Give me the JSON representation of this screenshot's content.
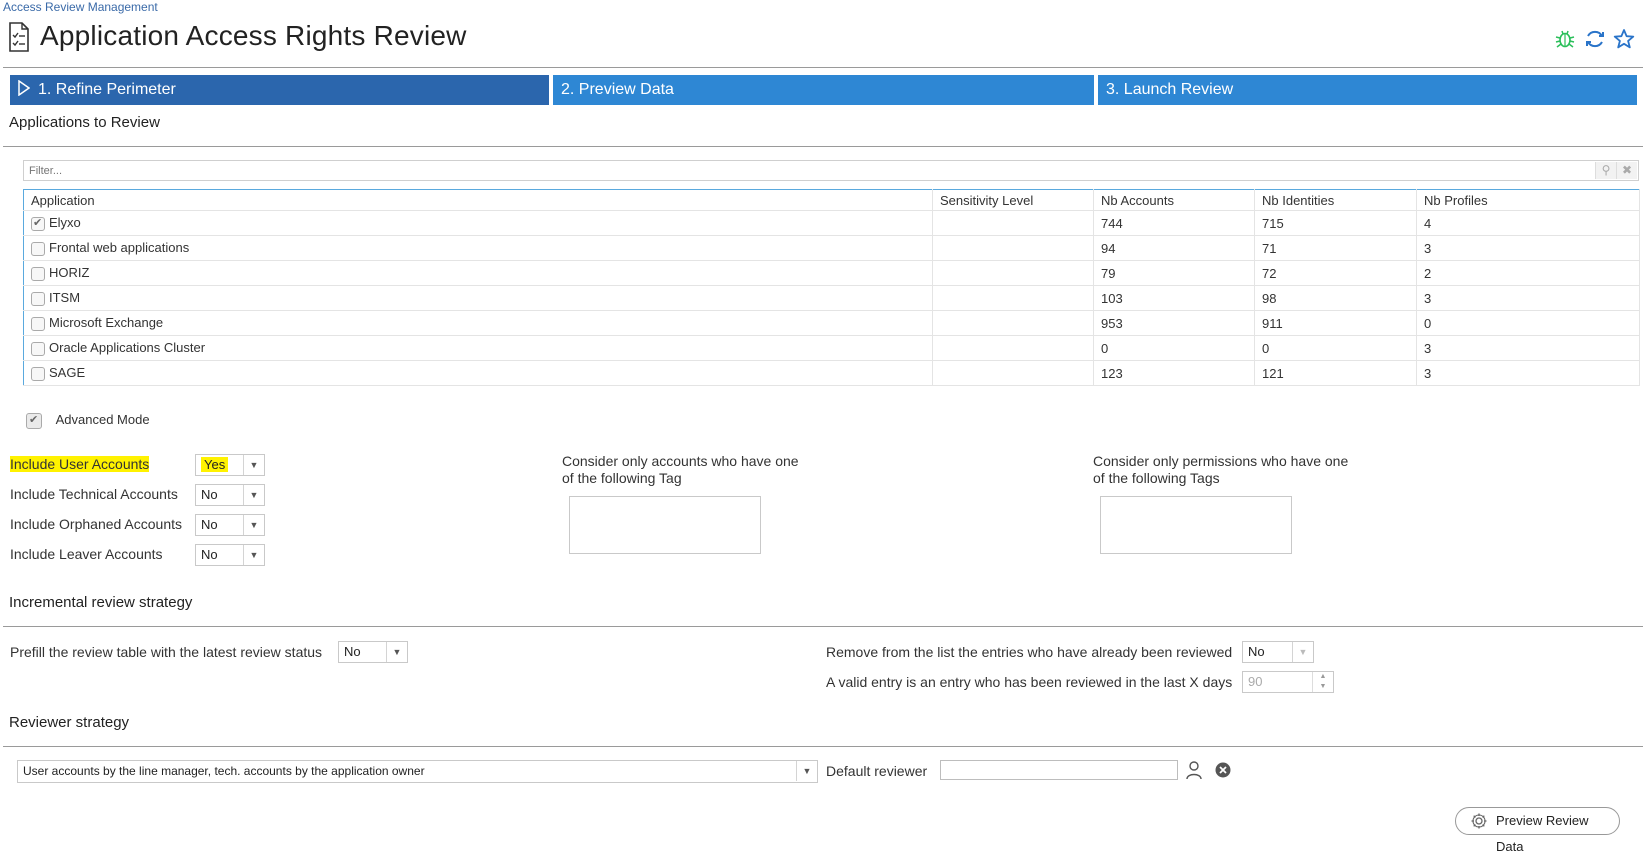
{
  "breadcrumb": "Access Review Management",
  "page_title": "Application Access Rights Review",
  "steps": [
    {
      "label": "1. Refine Perimeter"
    },
    {
      "label": "2. Preview Data"
    },
    {
      "label": "3. Launch Review"
    }
  ],
  "applications_section": {
    "heading": "Applications to Review",
    "filter_placeholder": "Filter...",
    "columns": [
      "Application",
      "Sensitivity Level",
      "Nb Accounts",
      "Nb Identities",
      "Nb Profiles"
    ],
    "rows": [
      {
        "name": "Elyxo",
        "checked": true,
        "sensitivity": "",
        "accounts": "744",
        "identities": "715",
        "profiles": "4"
      },
      {
        "name": "Frontal web applications",
        "checked": false,
        "sensitivity": "",
        "accounts": "94",
        "identities": "71",
        "profiles": "3"
      },
      {
        "name": "HORIZ",
        "checked": false,
        "sensitivity": "",
        "accounts": "79",
        "identities": "72",
        "profiles": "2"
      },
      {
        "name": "ITSM",
        "checked": false,
        "sensitivity": "",
        "accounts": "103",
        "identities": "98",
        "profiles": "3"
      },
      {
        "name": "Microsoft Exchange",
        "checked": false,
        "sensitivity": "",
        "accounts": "953",
        "identities": "911",
        "profiles": "0"
      },
      {
        "name": "Oracle Applications Cluster",
        "checked": false,
        "sensitivity": "",
        "accounts": "0",
        "identities": "0",
        "profiles": "3"
      },
      {
        "name": "SAGE",
        "checked": false,
        "sensitivity": "",
        "accounts": "123",
        "identities": "121",
        "profiles": "3"
      }
    ]
  },
  "advanced_mode": {
    "label": "Advanced Mode",
    "checked": true
  },
  "account_options": [
    {
      "label": "Include User Accounts",
      "value": "Yes",
      "highlighted": true
    },
    {
      "label": "Include Technical Accounts",
      "value": "No",
      "highlighted": false
    },
    {
      "label": "Include Orphaned Accounts",
      "value": "No",
      "highlighted": false
    },
    {
      "label": "Include Leaver Accounts",
      "value": "No",
      "highlighted": false
    }
  ],
  "tag_filters": {
    "accounts_line1": "Consider only accounts who have one",
    "accounts_line2": "of the following Tag",
    "permissions_line1": "Consider only permissions who have one",
    "permissions_line2": "of the following Tags"
  },
  "incremental": {
    "heading": "Incremental review strategy",
    "prefill_label": "Prefill the review table with the latest review status",
    "prefill_value": "No",
    "remove_label": "Remove from the list the entries who have already been reviewed",
    "remove_value": "No",
    "valid_entry_label": "A valid entry is an entry who has been reviewed in the last X days",
    "valid_entry_days": "90"
  },
  "reviewer": {
    "heading": "Reviewer strategy",
    "strategy_value": "User accounts by the line manager, tech. accounts by the application owner",
    "default_reviewer_label": "Default reviewer",
    "default_reviewer_value": ""
  },
  "preview_button": "Preview Review Data",
  "icons": {
    "title": "checklist-document-icon",
    "debug": "bug-icon",
    "refresh": "refresh-icon",
    "favorite": "star-icon",
    "user_pick": "user-icon",
    "clear": "clear-circle-icon",
    "gear": "gear-icon"
  },
  "colors": {
    "step_active": "#2b66ad",
    "step": "#2e87d4",
    "highlight": "#fff200",
    "bug_icon": "#2bbf5a",
    "accent_icon": "#2a74c9",
    "table_border": "#5aa9de"
  }
}
